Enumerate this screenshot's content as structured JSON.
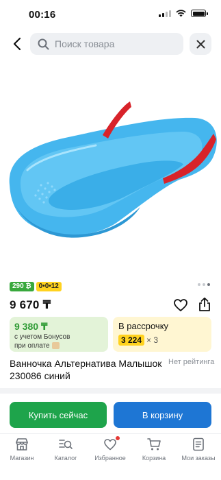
{
  "status_bar": {
    "time": "00:16"
  },
  "search": {
    "placeholder": "Поиск товара"
  },
  "product": {
    "badge_bonus": "290 ₿",
    "badge_installment": "0•0•12",
    "price": "9 670 ₸",
    "bonus_price": "9 380 ₸",
    "bonus_note_line1": "с учетом Бонусов",
    "bonus_note_line2": "при оплате",
    "installment_title": "В рассрочку",
    "installment_amount": "3 224",
    "installment_multiplier": "× 3",
    "title": "Ванночка Альтернатива Малышок 230086 синий",
    "rating": "Нет рейтинга",
    "image_dots": 3,
    "image_active_index": 2
  },
  "actions": {
    "buy_now": "Купить сейчас",
    "add_to_cart": "В корзину"
  },
  "tab_bar": {
    "items": [
      {
        "label": "Магазин",
        "icon": "shop-icon"
      },
      {
        "label": "Каталог",
        "icon": "catalog-icon"
      },
      {
        "label": "Избранное",
        "icon": "heart-icon"
      },
      {
        "label": "Корзина",
        "icon": "cart-icon"
      },
      {
        "label": "Мои заказы",
        "icon": "orders-icon"
      }
    ]
  },
  "colors": {
    "green": "#1ea44b",
    "blue": "#1e76d4",
    "yellow": "#ffd21f",
    "bath_blue": "#3aaee8",
    "handle_red": "#d8232a"
  }
}
